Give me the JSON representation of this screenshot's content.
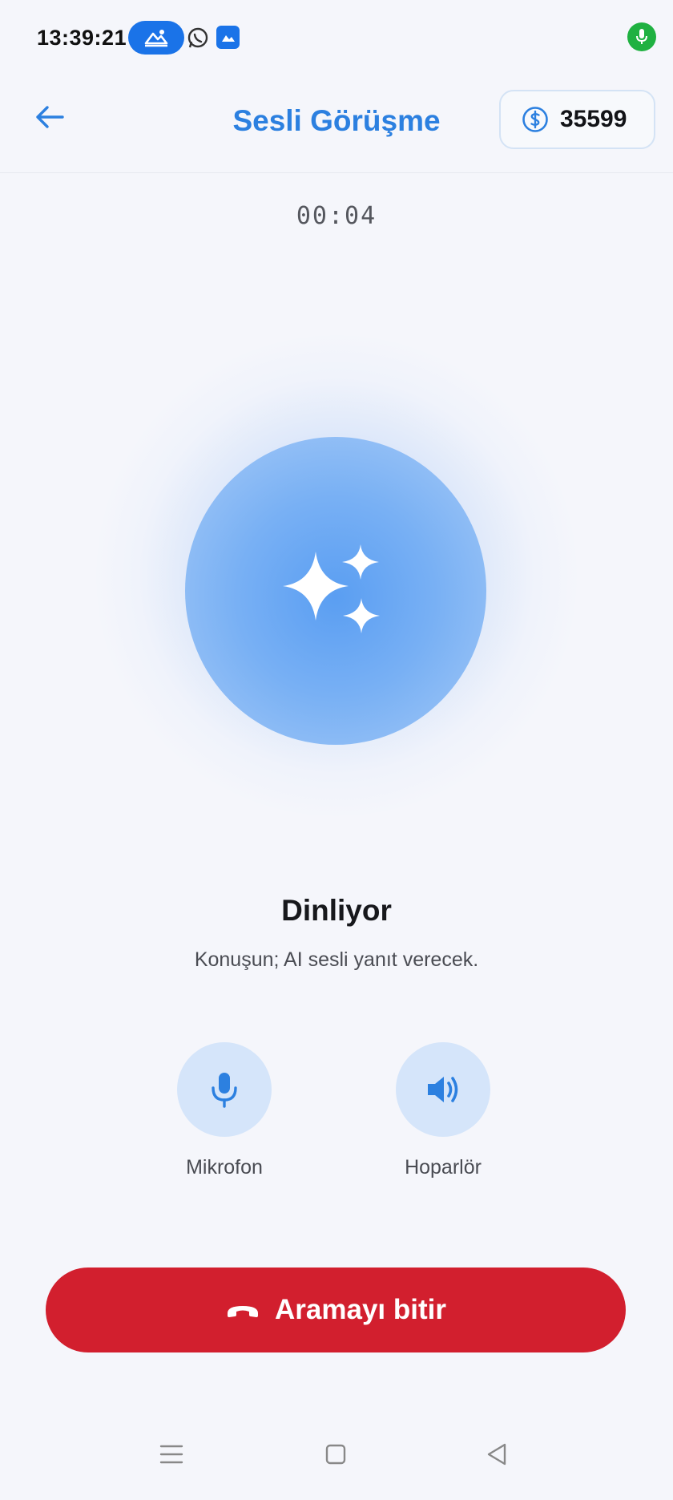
{
  "status_bar": {
    "time": "13:39:21"
  },
  "header": {
    "title": "Sesli Görüşme",
    "credits": "35599"
  },
  "call": {
    "timer": "00:04",
    "state_title": "Dinliyor",
    "state_subtitle": "Konuşun; AI sesli yanıt verecek."
  },
  "controls": {
    "microphone_label": "Mikrofon",
    "speaker_label": "Hoparlör"
  },
  "end_call": {
    "label": "Aramayı bitir"
  },
  "colors": {
    "accent": "#2c80e0",
    "danger": "#d21f2e",
    "control_bg": "#d5e5fa",
    "orb": "#5a9ef2"
  },
  "icons": [
    "back-arrow-icon",
    "coin-icon",
    "sparkles-icon",
    "microphone-icon",
    "speaker-icon",
    "phone-hangup-icon",
    "menu-icon",
    "home-square-icon",
    "back-triangle-icon"
  ]
}
